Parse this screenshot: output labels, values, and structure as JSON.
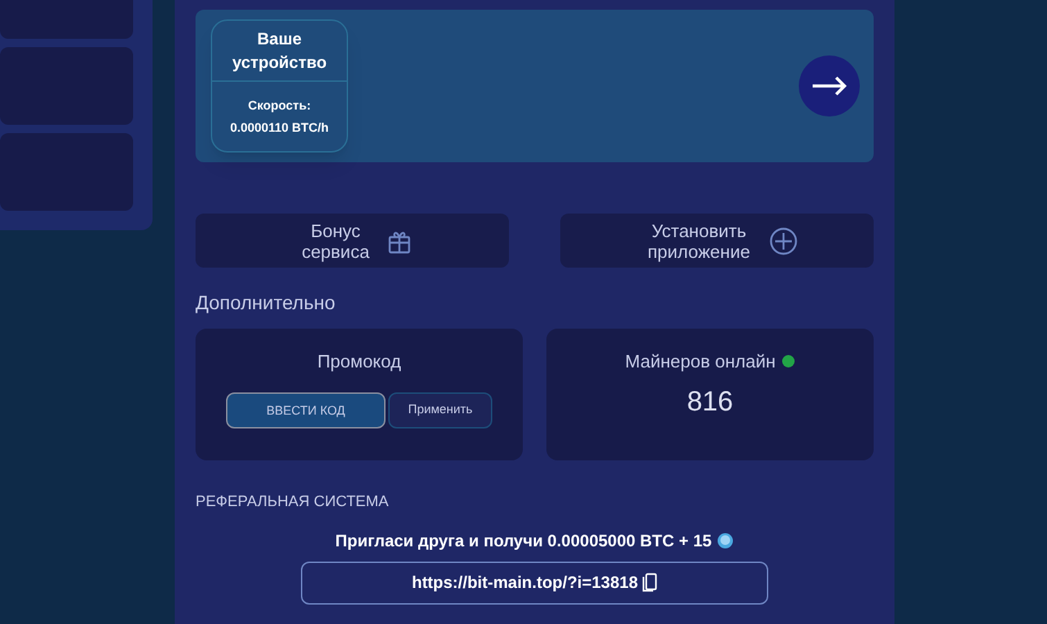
{
  "device_card": {
    "title": "Ваше устройство",
    "speed_label": "Скорость:",
    "speed_value": "0.0000110 BTC/h"
  },
  "actions": [
    {
      "label": "Бонус сервиса",
      "kind": "gift"
    },
    {
      "label": "Установить приложение",
      "kind": "plus"
    }
  ],
  "extra": {
    "heading": "Дополнительно",
    "promo": {
      "title": "Промокод",
      "placeholder": "ВВЕСТИ КОД",
      "apply": "Применить"
    },
    "miners": {
      "title": "Майнеров онлайн",
      "count": "816"
    }
  },
  "referral": {
    "heading": "РЕФЕРАЛЬНАЯ СИСТЕМА",
    "text": "Пригласи друга и получи 0.00005000 BTC + 15",
    "link": "https://bit-main.top/?i=13818"
  }
}
